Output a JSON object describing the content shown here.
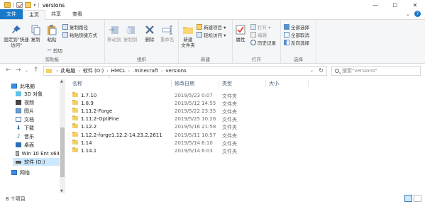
{
  "window": {
    "title": "versions",
    "minimize": "—",
    "maximize": "☐",
    "close": "✕"
  },
  "tabs": [
    {
      "label": "文件"
    },
    {
      "label": "主页"
    },
    {
      "label": "共享"
    },
    {
      "label": "查看"
    }
  ],
  "ribbon": {
    "clipboard": {
      "label": "剪贴板",
      "pin": "固定到\"快速访问\"",
      "copy": "复制",
      "paste": "粘贴",
      "copy_path": "复制路径",
      "paste_shortcut": "粘贴快捷方式",
      "cut": "剪切"
    },
    "organize": {
      "label": "组织",
      "move_to": "移动到",
      "copy_to": "复制到",
      "delete": "删除",
      "rename": "重命名"
    },
    "new": {
      "label": "新建",
      "new_folder": "新建\n文件夹",
      "new_item": "新建项目 ▾",
      "easy_access": "轻松访问 ▾"
    },
    "open": {
      "label": "打开",
      "properties": "属性",
      "open": "打开 ▾",
      "edit": "编辑",
      "history": "历史记录"
    },
    "select": {
      "label": "选择",
      "select_all": "全部选择",
      "select_none": "全部取消",
      "invert": "反向选择"
    }
  },
  "address": {
    "breadcrumbs": [
      "此电脑",
      "软件 (D:)",
      "HMCL",
      ".minecraft",
      "versions"
    ],
    "search_placeholder": "搜索\"versions\""
  },
  "nav_pane": {
    "items": [
      {
        "label": "此电脑",
        "icon": "pc-icon"
      },
      {
        "label": "3D 对象",
        "icon": "3d-icon"
      },
      {
        "label": "视频",
        "icon": "video-icon"
      },
      {
        "label": "图片",
        "icon": "picture-icon"
      },
      {
        "label": "文档",
        "icon": "document-icon"
      },
      {
        "label": "下载",
        "icon": "download-icon"
      },
      {
        "label": "音乐",
        "icon": "music-icon"
      },
      {
        "label": "桌面",
        "icon": "desktop-icon"
      },
      {
        "label": "Win 10 Ent x64",
        "icon": "drive-icon"
      },
      {
        "label": "软件 (D:)",
        "icon": "drive-icon",
        "selected": true
      },
      {
        "label": "网络",
        "icon": "network-icon"
      }
    ]
  },
  "columns": {
    "name": "名称",
    "date": "修改日期",
    "type": "类型",
    "size": "大小"
  },
  "files": [
    {
      "name": "1.7.10",
      "date": "2019/5/23 0:07",
      "type": "文件夹"
    },
    {
      "name": "1.8.9",
      "date": "2019/5/12 14:55",
      "type": "文件夹"
    },
    {
      "name": "1.11.2-Forge",
      "date": "2019/5/22 23:35",
      "type": "文件夹"
    },
    {
      "name": "1.11.2-OptiFine",
      "date": "2019/5/25 10:26",
      "type": "文件夹"
    },
    {
      "name": "1.12.2",
      "date": "2019/5/16 21:58",
      "type": "文件夹"
    },
    {
      "name": "1.12.2-forge1.12.2-14.23.2.2611",
      "date": "2019/5/11 10:57",
      "type": "文件夹"
    },
    {
      "name": "1.14",
      "date": "2019/5/14 6:10",
      "type": "文件夹"
    },
    {
      "name": "1.14.1",
      "date": "2019/5/14 6:03",
      "type": "文件夹"
    }
  ],
  "status": {
    "item_count": "8 个项目"
  },
  "colors": {
    "file_tab": "#1979ca",
    "selection": "#cce8ff",
    "folder": "#f5cf63"
  }
}
